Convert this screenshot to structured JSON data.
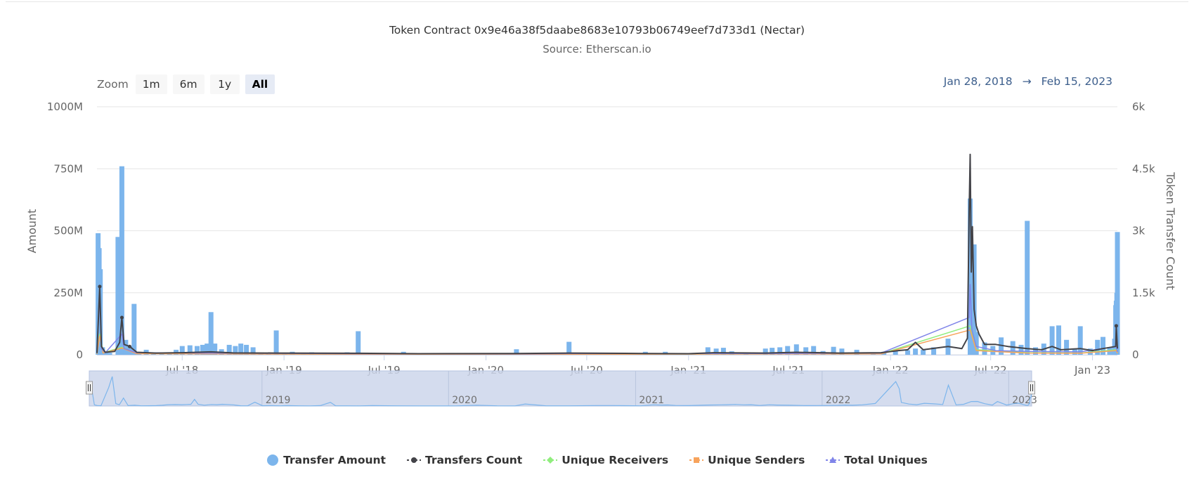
{
  "header": {
    "title": "Token Contract 0x9e46a38f5daabe8683e10793b06749eef7d733d1 (Nectar)",
    "subtitle": "Source: Etherscan.io"
  },
  "zoom": {
    "label": "Zoom",
    "buttons": [
      "1m",
      "6m",
      "1y",
      "All"
    ],
    "active": "All"
  },
  "range": {
    "from": "Jan 28, 2018",
    "arrow": "→",
    "to": "Feb 15, 2023"
  },
  "colors": {
    "transfer_amount": "#7cb5ec",
    "transfers_count": "#434348",
    "unique_receivers": "#90ed7d",
    "unique_senders": "#f7a35c",
    "total_uniques": "#8085e9",
    "navigator_fill": "#ccd6eb"
  },
  "legend": [
    {
      "name": "Transfer Amount",
      "icon": "circle",
      "color": "#7cb5ec"
    },
    {
      "name": "Transfers Count",
      "icon": "dash-circle",
      "color": "#434348"
    },
    {
      "name": "Unique Receivers",
      "icon": "dash-diamond",
      "color": "#90ed7d"
    },
    {
      "name": "Unique Senders",
      "icon": "dash-square",
      "color": "#f7a35c"
    },
    {
      "name": "Total Uniques",
      "icon": "dash-triangle",
      "color": "#8085e9"
    }
  ],
  "chart_data": {
    "type": "bar",
    "x_type": "datetime",
    "xlim": [
      "2018-01-28",
      "2023-02-15"
    ],
    "x_ticks": [
      "Jul '18",
      "Jan '19",
      "Jul '19",
      "Jan '20",
      "Jul '20",
      "Jan '21",
      "Jul '21",
      "Jan '22",
      "Jul '22",
      "Jan '23"
    ],
    "x_tick_dates": [
      "2018-07-01",
      "2019-01-01",
      "2019-07-01",
      "2020-01-01",
      "2020-07-01",
      "2021-01-01",
      "2021-07-01",
      "2022-01-01",
      "2022-07-01",
      "2023-01-01"
    ],
    "ylabel": "Amount",
    "ylim": [
      0,
      1000000000
    ],
    "y_ticks": [
      "0",
      "250M",
      "500M",
      "750M",
      "1000M"
    ],
    "ylabel_right": "Token Transfer Count",
    "ylim_right": [
      0,
      6000
    ],
    "y_ticks_right": [
      "0",
      "1.5k",
      "3k",
      "4.5k",
      "6k"
    ],
    "grid": true,
    "legend_position": "bottom",
    "navigator_labels": [
      "2019",
      "2020",
      "2021",
      "2022",
      "2023"
    ],
    "navigator_label_dates": [
      "2019-01-01",
      "2020-01-01",
      "2021-01-01",
      "2022-01-01",
      "2023-01-01"
    ],
    "series": [
      {
        "name": "Transfer Amount",
        "axis": "left",
        "chart": "column",
        "points": [
          [
            "2018-01-30",
            490000000
          ],
          [
            "2018-02-01",
            430000000
          ],
          [
            "2018-02-03",
            345000000
          ],
          [
            "2018-02-07",
            30000000
          ],
          [
            "2018-02-13",
            12000000
          ],
          [
            "2018-02-20",
            8000000
          ],
          [
            "2018-03-07",
            475000000
          ],
          [
            "2018-03-14",
            760000000
          ],
          [
            "2018-03-21",
            60000000
          ],
          [
            "2018-03-28",
            35000000
          ],
          [
            "2018-04-05",
            205000000
          ],
          [
            "2018-04-14",
            10000000
          ],
          [
            "2018-04-27",
            20000000
          ],
          [
            "2018-05-10",
            6000000
          ],
          [
            "2018-05-25",
            8000000
          ],
          [
            "2018-06-08",
            10000000
          ],
          [
            "2018-06-20",
            20000000
          ],
          [
            "2018-07-01",
            35000000
          ],
          [
            "2018-07-15",
            38000000
          ],
          [
            "2018-07-28",
            35000000
          ],
          [
            "2018-08-07",
            40000000
          ],
          [
            "2018-08-15",
            45000000
          ],
          [
            "2018-08-22",
            172000000
          ],
          [
            "2018-08-29",
            45000000
          ],
          [
            "2018-09-10",
            22000000
          ],
          [
            "2018-09-24",
            40000000
          ],
          [
            "2018-10-05",
            35000000
          ],
          [
            "2018-10-15",
            45000000
          ],
          [
            "2018-10-25",
            40000000
          ],
          [
            "2018-11-06",
            30000000
          ],
          [
            "2018-11-20",
            8000000
          ],
          [
            "2018-12-04",
            6000000
          ],
          [
            "2018-12-18",
            98000000
          ],
          [
            "2019-01-02",
            8000000
          ],
          [
            "2019-01-16",
            12000000
          ],
          [
            "2019-02-05",
            6000000
          ],
          [
            "2019-02-20",
            10000000
          ],
          [
            "2019-03-15",
            5000000
          ],
          [
            "2019-04-05",
            4000000
          ],
          [
            "2019-04-25",
            10000000
          ],
          [
            "2019-05-15",
            95000000
          ],
          [
            "2019-05-25",
            8000000
          ],
          [
            "2019-06-15",
            6000000
          ],
          [
            "2019-07-10",
            4000000
          ],
          [
            "2019-08-05",
            12000000
          ],
          [
            "2019-09-20",
            6000000
          ],
          [
            "2019-11-05",
            4000000
          ],
          [
            "2020-01-15",
            3000000
          ],
          [
            "2020-02-25",
            22000000
          ],
          [
            "2020-04-05",
            5000000
          ],
          [
            "2020-05-10",
            3000000
          ],
          [
            "2020-05-30",
            52000000
          ],
          [
            "2020-07-10",
            6000000
          ],
          [
            "2020-08-25",
            5000000
          ],
          [
            "2020-10-15",
            12000000
          ],
          [
            "2020-11-20",
            12000000
          ],
          [
            "2021-01-10",
            5000000
          ],
          [
            "2021-02-05",
            30000000
          ],
          [
            "2021-02-20",
            25000000
          ],
          [
            "2021-03-05",
            28000000
          ],
          [
            "2021-03-20",
            14000000
          ],
          [
            "2021-04-15",
            10000000
          ],
          [
            "2021-05-20",
            25000000
          ],
          [
            "2021-06-01",
            28000000
          ],
          [
            "2021-06-15",
            30000000
          ],
          [
            "2021-06-29",
            35000000
          ],
          [
            "2021-07-15",
            42000000
          ],
          [
            "2021-08-01",
            30000000
          ],
          [
            "2021-08-15",
            35000000
          ],
          [
            "2021-09-01",
            15000000
          ],
          [
            "2021-09-20",
            32000000
          ],
          [
            "2021-10-05",
            25000000
          ],
          [
            "2021-11-01",
            20000000
          ],
          [
            "2021-12-01",
            10000000
          ],
          [
            "2021-12-20",
            12000000
          ],
          [
            "2022-01-10",
            15000000
          ],
          [
            "2022-02-01",
            18000000
          ],
          [
            "2022-02-15",
            25000000
          ],
          [
            "2022-03-01",
            20000000
          ],
          [
            "2022-03-20",
            30000000
          ],
          [
            "2022-04-15",
            65000000
          ],
          [
            "2022-05-25",
            630000000
          ],
          [
            "2022-06-01",
            445000000
          ],
          [
            "2022-06-05",
            92000000
          ],
          [
            "2022-06-20",
            50000000
          ],
          [
            "2022-07-05",
            35000000
          ],
          [
            "2022-07-20",
            70000000
          ],
          [
            "2022-08-10",
            55000000
          ],
          [
            "2022-08-25",
            40000000
          ],
          [
            "2022-09-05",
            540000000
          ],
          [
            "2022-09-20",
            30000000
          ],
          [
            "2022-10-05",
            45000000
          ],
          [
            "2022-10-20",
            115000000
          ],
          [
            "2022-11-01",
            118000000
          ],
          [
            "2022-11-15",
            60000000
          ],
          [
            "2022-11-30",
            25000000
          ],
          [
            "2022-12-10",
            115000000
          ],
          [
            "2022-12-28",
            25000000
          ],
          [
            "2023-01-10",
            60000000
          ],
          [
            "2023-01-20",
            72000000
          ],
          [
            "2023-02-01",
            30000000
          ],
          [
            "2023-02-05",
            18000000
          ],
          [
            "2023-02-08",
            20000000
          ],
          [
            "2023-02-10",
            65000000
          ],
          [
            "2023-02-11",
            60000000
          ],
          [
            "2023-02-12",
            200000000
          ],
          [
            "2023-02-13",
            218000000
          ],
          [
            "2023-02-14",
            250000000
          ],
          [
            "2023-02-15",
            495000000
          ]
        ]
      },
      {
        "name": "Transfers Count",
        "axis": "right",
        "chart": "line",
        "points": [
          [
            "2018-01-28",
            40
          ],
          [
            "2018-02-02",
            1650
          ],
          [
            "2018-02-05",
            200
          ],
          [
            "2018-02-12",
            60
          ],
          [
            "2018-03-01",
            80
          ],
          [
            "2018-03-10",
            300
          ],
          [
            "2018-03-14",
            900
          ],
          [
            "2018-03-18",
            250
          ],
          [
            "2018-03-28",
            200
          ],
          [
            "2018-04-10",
            60
          ],
          [
            "2018-05-15",
            40
          ],
          [
            "2018-07-01",
            50
          ],
          [
            "2018-08-22",
            70
          ],
          [
            "2018-10-01",
            45
          ],
          [
            "2018-12-18",
            40
          ],
          [
            "2019-05-15",
            35
          ],
          [
            "2019-09-01",
            25
          ],
          [
            "2020-02-25",
            30
          ],
          [
            "2020-05-30",
            40
          ],
          [
            "2020-10-15",
            30
          ],
          [
            "2021-01-01",
            25
          ],
          [
            "2021-02-15",
            50
          ],
          [
            "2021-05-20",
            40
          ],
          [
            "2021-07-15",
            60
          ],
          [
            "2021-10-01",
            40
          ],
          [
            "2021-12-15",
            50
          ],
          [
            "2022-01-15",
            100
          ],
          [
            "2022-02-01",
            120
          ],
          [
            "2022-02-15",
            300
          ],
          [
            "2022-03-01",
            120
          ],
          [
            "2022-04-15",
            200
          ],
          [
            "2022-05-10",
            150
          ],
          [
            "2022-05-20",
            400
          ],
          [
            "2022-05-23",
            3400
          ],
          [
            "2022-05-25",
            4850
          ],
          [
            "2022-05-27",
            2000
          ],
          [
            "2022-05-29",
            3100
          ],
          [
            "2022-06-01",
            1100
          ],
          [
            "2022-06-05",
            700
          ],
          [
            "2022-06-10",
            500
          ],
          [
            "2022-06-20",
            250
          ],
          [
            "2022-07-10",
            250
          ],
          [
            "2022-08-01",
            200
          ],
          [
            "2022-09-05",
            150
          ],
          [
            "2022-10-01",
            120
          ],
          [
            "2022-10-20",
            200
          ],
          [
            "2022-11-05",
            120
          ],
          [
            "2022-12-10",
            150
          ],
          [
            "2023-01-01",
            100
          ],
          [
            "2023-01-20",
            150
          ],
          [
            "2023-02-12",
            200
          ],
          [
            "2023-02-13",
            700
          ],
          [
            "2023-02-15",
            150
          ]
        ]
      },
      {
        "name": "Unique Receivers",
        "axis": "right",
        "chart": "line",
        "points": [
          [
            "2018-01-28",
            20
          ],
          [
            "2018-02-02",
            500
          ],
          [
            "2018-02-08",
            50
          ],
          [
            "2018-03-14",
            180
          ],
          [
            "2018-04-10",
            30
          ],
          [
            "2018-08-22",
            25
          ],
          [
            "2019-05-15",
            15
          ],
          [
            "2020-05-30",
            15
          ],
          [
            "2021-06-01",
            20
          ],
          [
            "2021-12-15",
            25
          ],
          [
            "2022-05-25",
            700
          ],
          [
            "2022-06-05",
            120
          ],
          [
            "2022-09-05",
            50
          ],
          [
            "2022-12-10",
            40
          ],
          [
            "2023-02-13",
            120
          ],
          [
            "2023-02-15",
            40
          ]
        ]
      },
      {
        "name": "Unique Senders",
        "axis": "right",
        "chart": "line",
        "points": [
          [
            "2018-01-28",
            20
          ],
          [
            "2018-02-02",
            450
          ],
          [
            "2018-02-08",
            40
          ],
          [
            "2018-03-14",
            160
          ],
          [
            "2018-04-10",
            25
          ],
          [
            "2018-08-22",
            20
          ],
          [
            "2019-05-15",
            12
          ],
          [
            "2020-05-30",
            12
          ],
          [
            "2021-06-01",
            18
          ],
          [
            "2021-12-15",
            20
          ],
          [
            "2022-05-25",
            600
          ],
          [
            "2022-06-05",
            100
          ],
          [
            "2022-09-05",
            40
          ],
          [
            "2022-12-10",
            35
          ],
          [
            "2023-02-13",
            100
          ],
          [
            "2023-02-15",
            35
          ]
        ]
      },
      {
        "name": "Total Uniques",
        "axis": "right",
        "chart": "line",
        "points": [
          [
            "2018-01-28",
            40
          ],
          [
            "2018-02-02",
            1400
          ],
          [
            "2018-02-05",
            150
          ],
          [
            "2018-02-12",
            50
          ],
          [
            "2018-03-14",
            500
          ],
          [
            "2018-03-18",
            150
          ],
          [
            "2018-04-10",
            50
          ],
          [
            "2018-08-22",
            40
          ],
          [
            "2019-05-15",
            25
          ],
          [
            "2020-02-25",
            20
          ],
          [
            "2020-05-30",
            30
          ],
          [
            "2021-06-01",
            30
          ],
          [
            "2021-12-15",
            40
          ],
          [
            "2022-05-23",
            900
          ],
          [
            "2022-05-25",
            1700
          ],
          [
            "2022-05-28",
            600
          ],
          [
            "2022-06-05",
            200
          ],
          [
            "2022-07-10",
            100
          ],
          [
            "2022-09-05",
            80
          ],
          [
            "2022-12-10",
            70
          ],
          [
            "2023-02-13",
            200
          ],
          [
            "2023-02-15",
            70
          ]
        ]
      }
    ]
  }
}
